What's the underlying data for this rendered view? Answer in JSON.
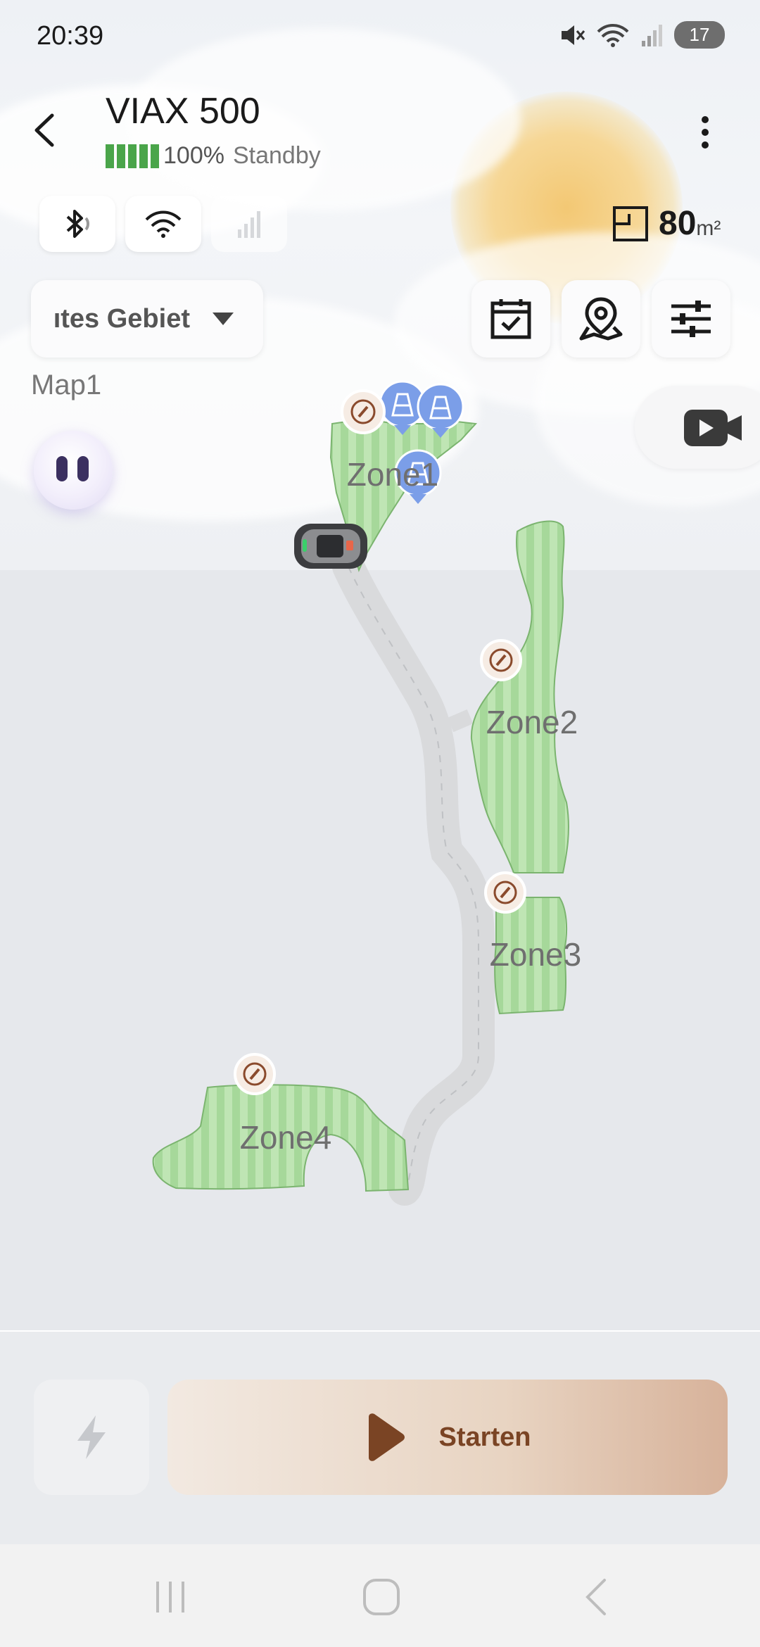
{
  "status_bar": {
    "time": "20:39",
    "battery": "17",
    "icons": [
      "mute-icon",
      "wifi-icon",
      "signal-icon"
    ]
  },
  "header": {
    "title": "VIAX 500",
    "battery_percent": "100%",
    "battery_level": 1.0,
    "status": "Standby"
  },
  "connectivity": {
    "bluetooth": "active",
    "wifi": "active",
    "cellular": "inactive"
  },
  "area": {
    "value": "80",
    "unit": "m²"
  },
  "area_selector": {
    "selected": "Alles Gebiet",
    "visible_text": "ıtes Gebiet"
  },
  "toolbar": {
    "icons": [
      "schedule-icon",
      "map-pin-icon",
      "settings-sliders-icon"
    ]
  },
  "map": {
    "name": "Map1",
    "zones": [
      {
        "label": "Zone1"
      },
      {
        "label": "Zone2"
      },
      {
        "label": "Zone3"
      },
      {
        "label": "Zone4"
      }
    ]
  },
  "actions": {
    "charge_icon": "lightning-icon",
    "start_label": "Starten"
  },
  "colors": {
    "zone_fill": "#bfe5b4",
    "zone_stripe": "#a6d89a",
    "zone_border": "#7bb46f",
    "path": "#d9dadc",
    "battery_green": "#4aa54a",
    "start_text": "#7a4424",
    "marker_blue": "#7b9ee8",
    "marker_brown": "#8a4a2c"
  }
}
